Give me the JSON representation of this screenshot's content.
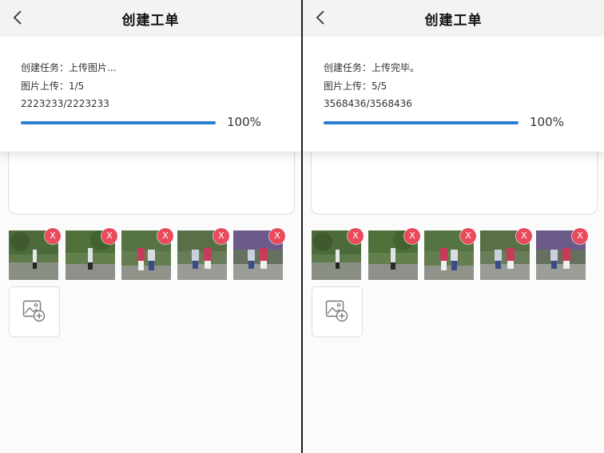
{
  "title": "创建工单",
  "panes": [
    {
      "task_line": "创建任务：上传图片...",
      "image_upload_line": "图片上传：1/5",
      "bytes_line": "2223233/2223233",
      "progress_percent_label": "100%",
      "progress_fraction": 1.0,
      "delete_label": "X"
    },
    {
      "task_line": "创建任务：上传完毕。",
      "image_upload_line": "图片上传：5/5",
      "bytes_line": "3568436/3568436",
      "progress_percent_label": "100%",
      "progress_fraction": 1.0,
      "delete_label": "X"
    }
  ],
  "colors": {
    "progress": "#2a7fcf",
    "delete_badge": "#e94b5c",
    "header_bg": "#f3f3f3"
  },
  "icons": {
    "back": "chevron-left-icon",
    "delete": "close-icon",
    "add_image": "add-image-icon"
  }
}
